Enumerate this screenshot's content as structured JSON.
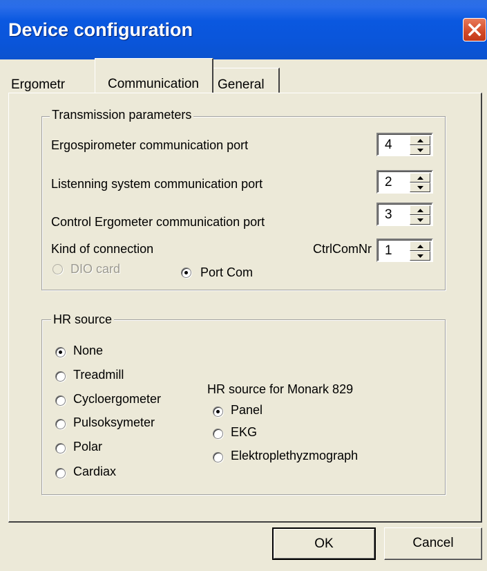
{
  "window": {
    "title": "Device configuration"
  },
  "tabs": [
    {
      "label": "Ergometr",
      "active": false
    },
    {
      "label": "Communication",
      "active": true
    },
    {
      "label": "General",
      "active": false
    }
  ],
  "transmission": {
    "legend": "Transmission parameters",
    "ergospirometer_label": "Ergospirometer communication port",
    "ergospirometer_value": "4",
    "listening_label": "Listenning system communication port",
    "listening_value": "2",
    "control_label": "Control Ergometer communication port",
    "control_value": "3",
    "kind_label": "Kind of connection",
    "ctrl_com_label": "CtrlComNr",
    "ctrl_com_value": "1",
    "connection_options": [
      {
        "label": "DIO card",
        "checked": false,
        "disabled": true
      },
      {
        "label": "Port Com",
        "checked": true,
        "disabled": false
      }
    ]
  },
  "hr_source": {
    "legend": "HR source",
    "options": [
      {
        "label": "None",
        "checked": true
      },
      {
        "label": "Treadmill",
        "checked": false
      },
      {
        "label": "Cycloergometer",
        "checked": false
      },
      {
        "label": "Pulsoksymeter",
        "checked": false
      },
      {
        "label": "Polar",
        "checked": false
      },
      {
        "label": "Cardiax",
        "checked": false
      }
    ],
    "monark_label": "HR source for Monark 829",
    "monark_options": [
      {
        "label": "Panel",
        "checked": true
      },
      {
        "label": "EKG",
        "checked": false
      },
      {
        "label": "Elektroplethyzmograph",
        "checked": false
      }
    ]
  },
  "buttons": {
    "ok": "OK",
    "cancel": "Cancel"
  },
  "colors": {
    "titlebar": "#0a55da",
    "face": "#ece9d8",
    "close": "#d34a28"
  },
  "icons": {
    "close": "close-icon",
    "spin_up": "arrow-up-icon",
    "spin_down": "arrow-down-icon"
  }
}
